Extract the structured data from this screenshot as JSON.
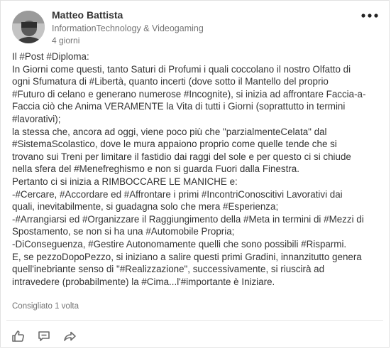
{
  "author": {
    "name": "Matteo Battista",
    "headline": "InformationTechnology & Videogaming",
    "timestamp": "4 giorni"
  },
  "post": {
    "lines": [
      "Il #Post #Diploma:",
      "In Giorni come questi, tanto Saturi di Profumi i quali coccolano il nostro Olfatto di",
      "ogni Sfumatura di #Libertà, quanto incerti (dove sotto il Mantello del proprio",
      "#Futuro di celano e generano numerose #Incognite), si inizia ad affrontare Faccia-a-",
      "Faccia ciò che Anima VERAMENTE la Vita di tutti i Giorni (soprattutto in termini",
      "#lavorativi);",
      "la stessa che, ancora ad oggi, viene poco più che \"parzialmenteCelata\" dal",
      "#SistemaScolastico, dove le mura appaiono proprio come quelle tende che si",
      "trovano sui Treni per limitare il fastidio dai raggi del sole e per questo ci si chiude",
      "nella sfera del #Menefreghismo e non si guarda Fuori dalla Finestra.",
      "Pertanto ci si inizia a RIMBOCCARE LE MANICHE e:",
      "-#Cercare, #Accordare ed #Affrontare i primi #IncontriConoscitivi Lavorativi dai",
      "quali, inevitabilmente, si guadagna solo che mera #Esperienza;",
      "-#Arrangiarsi ed #Organizzare il Raggiungimento della #Meta in termini di #Mezzi di",
      "Spostamento, se non si ha una #Automobile Propria;",
      "-DiConseguenza, #Gestire Autonomamente quelli che sono possibili #Risparmi.",
      "E, se pezzoDopoPezzo, si iniziano a salire questi primi Gradini, innanzitutto genera",
      "quell'inebriante senso di \"#Realizzazione\", successivamente, si riuscirà ad",
      "intravedere (probabilmente) la #Cima...l'#importante è Iniziare."
    ]
  },
  "social": {
    "likes_text": "Consigliato 1 volta"
  },
  "icons": {
    "menu": "more-horizontal-icon",
    "like": "thumbs-up-icon",
    "comment": "comment-icon",
    "share": "share-icon"
  },
  "colors": {
    "text": "#333333",
    "secondary_text": "#737373",
    "icon": "#6b6b6b",
    "divider": "#e6e6e6"
  }
}
